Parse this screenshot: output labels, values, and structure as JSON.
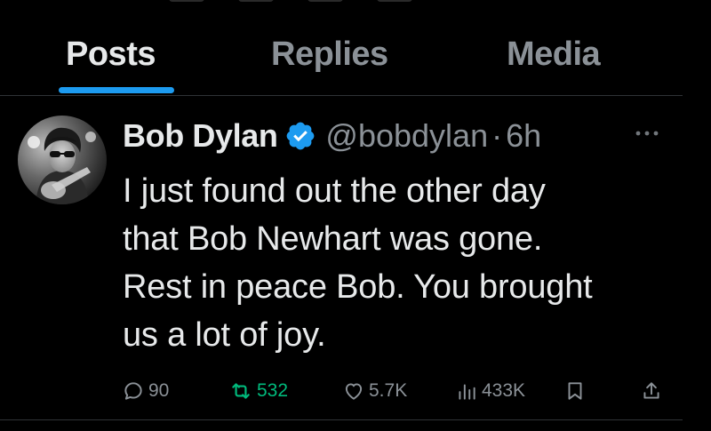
{
  "tabs": [
    {
      "label": "Posts",
      "active": true
    },
    {
      "label": "Replies",
      "active": false
    },
    {
      "label": "Media",
      "active": false
    }
  ],
  "post": {
    "author_name": "Bob Dylan",
    "handle": "@bobdylan",
    "separator": "·",
    "time": "6h",
    "verified": true,
    "avatar_icon": "profile-photo",
    "text": "I just found out the other day\nthat Bob Newhart was gone.\nRest in peace Bob. You brought\nus a lot of joy.",
    "actions": {
      "replies": "90",
      "reposts": "532",
      "likes": "5.7K",
      "views": "433K"
    }
  },
  "colors": {
    "background": "#000000",
    "text_primary": "#e7e9ea",
    "text_secondary": "#8b9197",
    "accent": "#1d9bf0",
    "repost_active": "#00ba7c",
    "divider": "#2f3336"
  }
}
